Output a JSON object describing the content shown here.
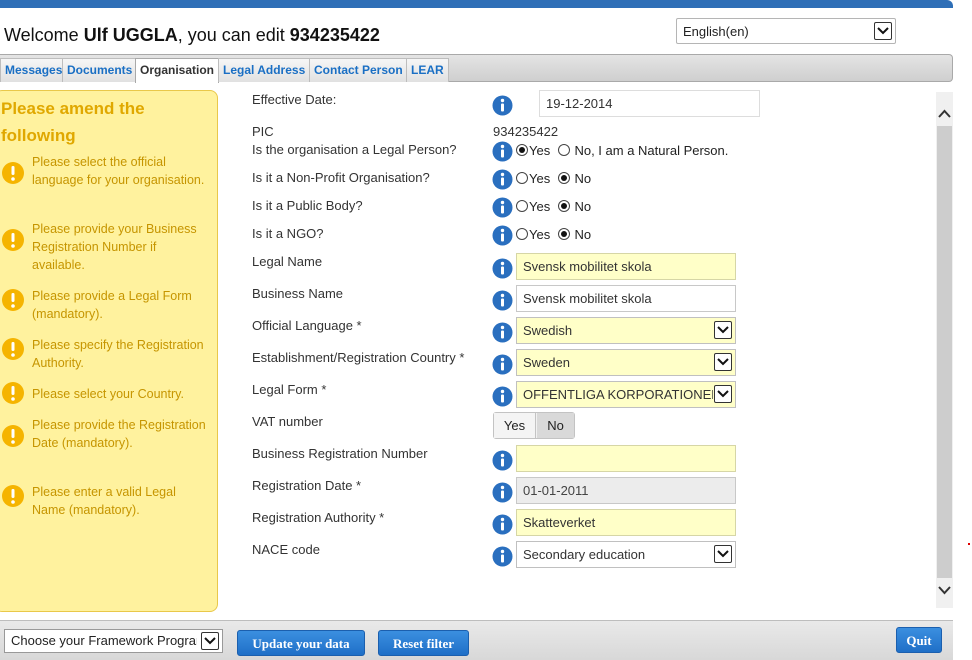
{
  "header": {
    "welcome_prefix": "Welcome ",
    "user_name": "Ulf UGGLA",
    "welcome_mid": ", you can edit ",
    "pic": "934235422",
    "language": "English(en)"
  },
  "tabs": [
    {
      "label": "Messages",
      "active": false
    },
    {
      "label": "Documents",
      "active": false
    },
    {
      "label": "Organisation",
      "active": true
    },
    {
      "label": "Legal Address",
      "active": false
    },
    {
      "label": "Contact Person",
      "active": false
    },
    {
      "label": "LEAR",
      "active": false
    }
  ],
  "alerts": {
    "title": "Please amend the following",
    "items": [
      "Please select the official language for your organisation.",
      "Please provide your Business Registration Number if available.",
      "Please provide a Legal Form (mandatory).",
      "Please specify the Registration Authority.",
      "Please select your Country.",
      "Please provide the Registration Date (mandatory).",
      "Please enter a valid Legal Name (mandatory)."
    ]
  },
  "form": {
    "effective_date_label": "Effective Date:",
    "effective_date_value": "19-12-2014",
    "pic_label": "PIC",
    "pic_value": "934235422",
    "legal_person_label": "Is the organisation a Legal Person?",
    "legal_person_yes": "Yes",
    "legal_person_no": "No, I am a Natural Person.",
    "non_profit_label": "Is it a Non-Profit Organisation?",
    "public_body_label": "Is it a Public Body?",
    "ngo_label": "Is it a NGO?",
    "yes": "Yes",
    "no": "No",
    "legal_name_label": "Legal Name",
    "legal_name_value": "Svensk mobilitet skola",
    "business_name_label": "Business Name",
    "business_name_value": "Svensk mobilitet skola",
    "official_language_label": "Official Language *",
    "official_language_value": "Swedish",
    "country_label": "Establishment/Registration Country *",
    "country_value": "Sweden",
    "legal_form_label": "Legal Form *",
    "legal_form_value": "OFFENTLIGA KORPORATIONER OCH ANSTALTER",
    "vat_label": "VAT number",
    "vat_yes": "Yes",
    "vat_no": "No",
    "brn_label": "Business Registration Number",
    "brn_value": "",
    "reg_date_label": "Registration Date *",
    "reg_date_value": "01-01-2011",
    "reg_authority_label": "Registration Authority *",
    "reg_authority_value": "Skatteverket",
    "nace_label": "NACE code",
    "nace_value": "Secondary education"
  },
  "footer": {
    "framework_placeholder": "Choose your Framework Programme",
    "update_button": "Update your data",
    "reset_button": "Reset filter",
    "quit_button": "Quit"
  },
  "colors": {
    "accent_blue": "#1f6fc7",
    "alert_bg": "#fff29e",
    "alert_text": "#c69500",
    "field_required_bg": "#ffffc8"
  }
}
